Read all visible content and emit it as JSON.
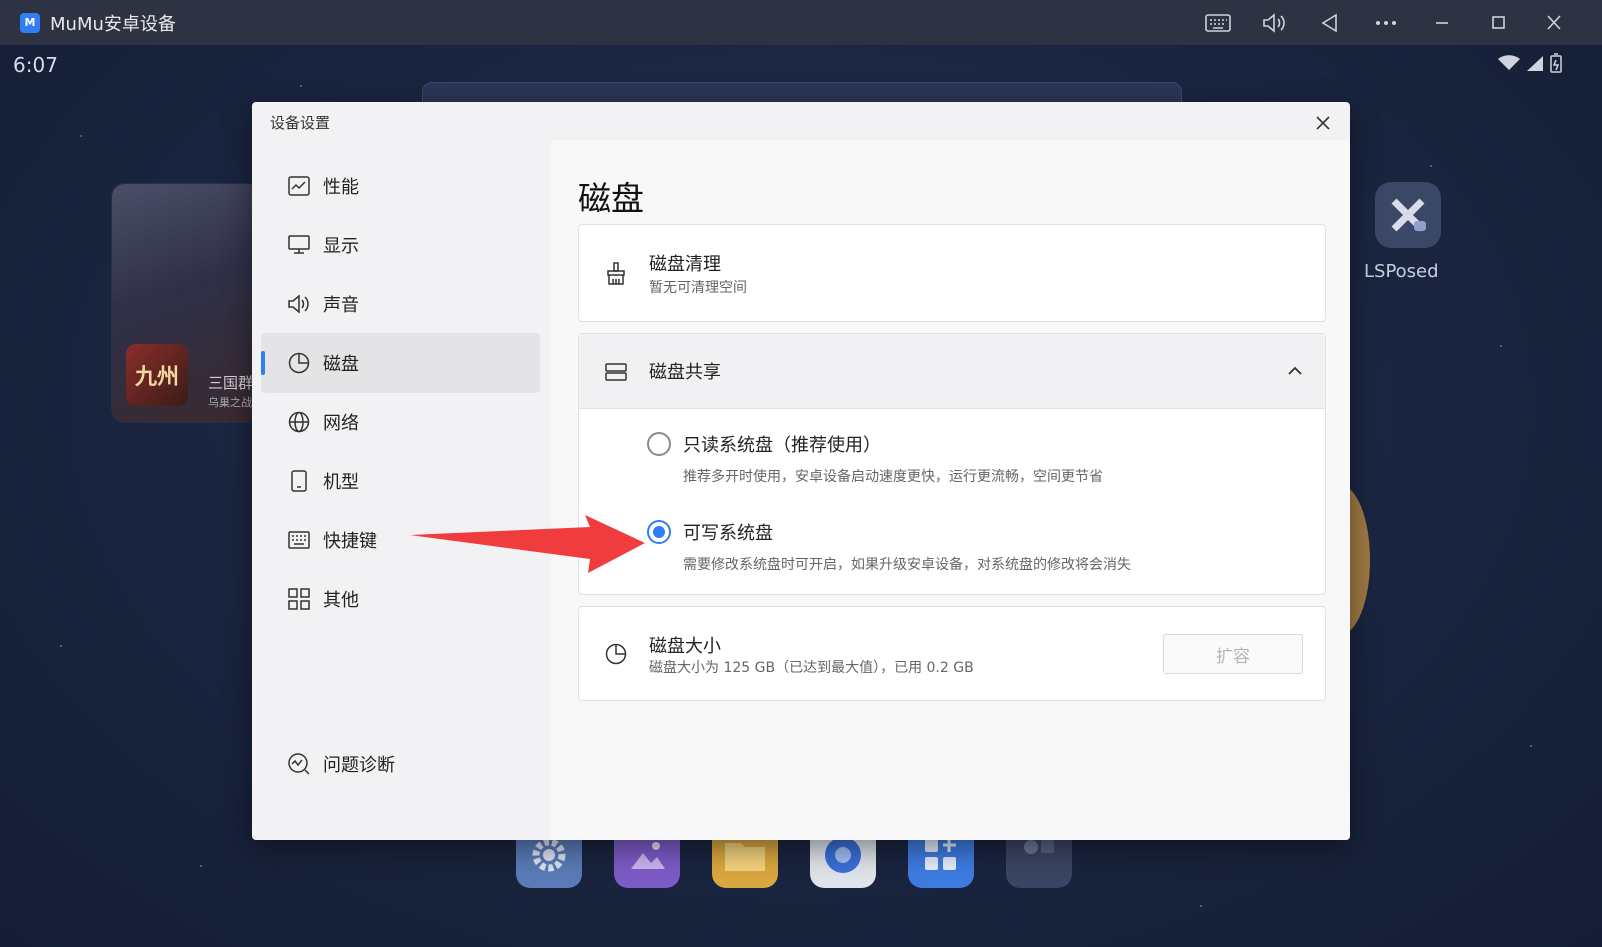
{
  "window": {
    "title": "MuMu安卓设备",
    "logo_text": "M"
  },
  "android": {
    "time": "6:07",
    "game_card": {
      "icon_text": "九州",
      "title": "三国群",
      "subtitle": "乌巢之战"
    },
    "lsposed_label": "LSPosed"
  },
  "dialog": {
    "title": "设备设置",
    "sidebar": {
      "items": [
        {
          "label": "性能",
          "icon": "performance-icon"
        },
        {
          "label": "显示",
          "icon": "display-icon"
        },
        {
          "label": "声音",
          "icon": "sound-icon"
        },
        {
          "label": "磁盘",
          "icon": "disk-icon",
          "active": true
        },
        {
          "label": "网络",
          "icon": "network-icon"
        },
        {
          "label": "机型",
          "icon": "phone-icon"
        },
        {
          "label": "快捷键",
          "icon": "keyboard-icon"
        },
        {
          "label": "其他",
          "icon": "grid-icon"
        }
      ],
      "diagnose_label": "问题诊断"
    },
    "content": {
      "title": "磁盘",
      "cleanup": {
        "title": "磁盘清理",
        "subtitle": "暂无可清理空间"
      },
      "share": {
        "title": "磁盘共享",
        "options": [
          {
            "title": "只读系统盘（推荐使用）",
            "desc": "推荐多开时使用，安卓设备启动速度更快，运行更流畅，空间更节省",
            "checked": false
          },
          {
            "title": "可写系统盘",
            "desc": "需要修改系统盘时可开启，如果升级安卓设备，对系统盘的修改将会消失",
            "checked": true
          }
        ]
      },
      "size": {
        "title": "磁盘大小",
        "subtitle": "磁盘大小为 125 GB（已达到最大值），已用 0.2 GB",
        "expand_label": "扩容"
      }
    }
  },
  "colors": {
    "accent": "#2f7ef5",
    "arrow": "#f03c3c"
  }
}
